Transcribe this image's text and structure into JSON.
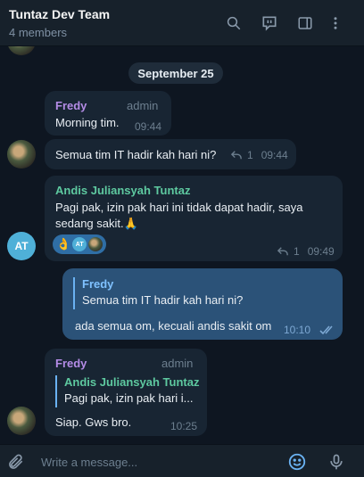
{
  "header": {
    "title": "Tuntaz Dev Team",
    "subtitle": "4 members"
  },
  "date_separator": "September 25",
  "messages": [
    {
      "sender": "Fredy",
      "role": "admin",
      "text": "Morning tim.",
      "time": "09:44"
    },
    {
      "text": "Semua tim IT hadir kah hari ni?",
      "replies": "1",
      "time": "09:44"
    },
    {
      "sender": "Andis Juliansyah Tuntaz",
      "text_line1": "Pagi pak, izin pak hari ini tidak dapat hadir, saya",
      "text_line2": "sedang sakit.🙏",
      "reaction_emoji": "👌",
      "reaction_avatar": "AT",
      "replies": "1",
      "time": "09:49",
      "avatar_initials": "AT"
    },
    {
      "quote_name": "Fredy",
      "quote_text": "Semua tim IT hadir kah hari ni?",
      "text": "ada semua om, kecuali andis sakit om",
      "time": "10:10"
    },
    {
      "sender": "Fredy",
      "role": "admin",
      "quote_name": "Andis Juliansyah Tuntaz",
      "quote_text": "Pagi pak, izin pak hari i...",
      "text": "Siap. Gws bro.",
      "time": "10:25"
    }
  ],
  "composer": {
    "placeholder": "Write a message..."
  },
  "colors": {
    "fredy": "#b48ce6",
    "andis": "#5ec9a0",
    "accent": "#6ab2f2",
    "outgoing_bubble": "#2b5278"
  },
  "icons": [
    "search-icon",
    "discussion-icon",
    "sidebar-icon",
    "more-icon",
    "reply-icon",
    "double-check-icon",
    "attach-icon",
    "emoji-icon",
    "microphone-icon"
  ]
}
